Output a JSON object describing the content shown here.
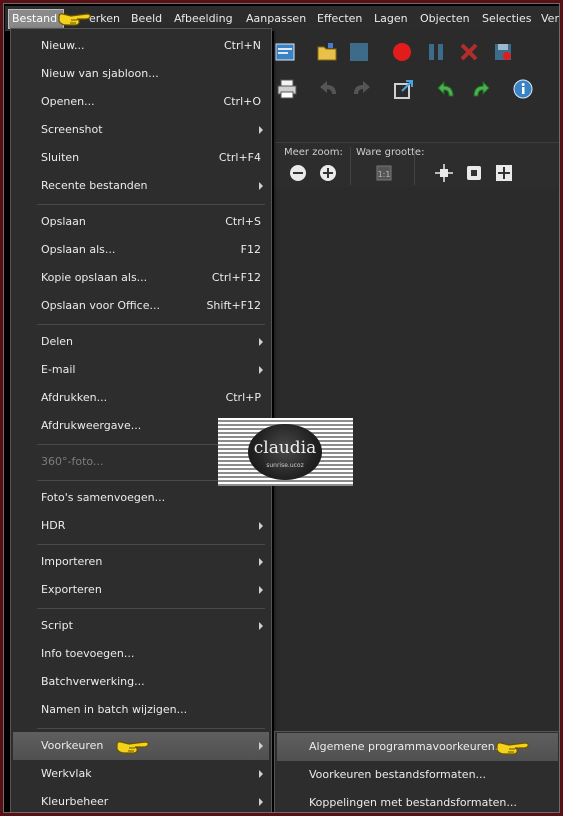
{
  "menubar": {
    "items": [
      "Bestand",
      "Bewerken",
      "Beeld",
      "Afbeelding",
      "Aanpassen",
      "Effecten",
      "Lagen",
      "Objecten",
      "Selecties",
      "Ven"
    ],
    "visible_text": [
      "Bestand",
      "erken",
      "Beeld",
      "Afbeelding",
      "Aanpassen",
      "Effecten",
      "Lagen",
      "Objecten",
      "Selecties",
      "Ven"
    ]
  },
  "toolbar": {
    "zoom_more_label": "Meer zoom:",
    "actual_size_label": "Ware grootte:"
  },
  "file_menu": {
    "items": [
      {
        "label": "Nieuw...",
        "shortcut": "Ctrl+N"
      },
      {
        "label": "Nieuw van sjabloon...",
        "shortcut": ""
      },
      {
        "label": "Openen...",
        "shortcut": "Ctrl+O"
      },
      {
        "label": "Screenshot",
        "shortcut": ""
      },
      {
        "label": "Sluiten",
        "shortcut": "Ctrl+F4"
      },
      {
        "label": "Recente bestanden",
        "shortcut": ""
      },
      {
        "label": "Opslaan",
        "shortcut": "Ctrl+S"
      },
      {
        "label": "Opslaan als...",
        "shortcut": "F12"
      },
      {
        "label": "Kopie opslaan als...",
        "shortcut": "Ctrl+F12"
      },
      {
        "label": "Opslaan voor Office...",
        "shortcut": "Shift+F12"
      },
      {
        "label": "Delen",
        "shortcut": ""
      },
      {
        "label": "E-mail",
        "shortcut": ""
      },
      {
        "label": "Afdrukken...",
        "shortcut": "Ctrl+P"
      },
      {
        "label": "Afdrukweergave...",
        "shortcut": ""
      },
      {
        "label": "360°-foto...",
        "shortcut": ""
      },
      {
        "label": "Foto's samenvoegen...",
        "shortcut": ""
      },
      {
        "label": "HDR",
        "shortcut": ""
      },
      {
        "label": "Importeren",
        "shortcut": ""
      },
      {
        "label": "Exporteren",
        "shortcut": ""
      },
      {
        "label": "Script",
        "shortcut": ""
      },
      {
        "label": "Info toevoegen...",
        "shortcut": ""
      },
      {
        "label": "Batchverwerking...",
        "shortcut": ""
      },
      {
        "label": "Namen in batch wijzigen...",
        "shortcut": ""
      },
      {
        "label": "Voorkeuren",
        "shortcut": ""
      },
      {
        "label": "Werkvlak",
        "shortcut": ""
      },
      {
        "label": "Kleurbeheer",
        "shortcut": ""
      }
    ]
  },
  "preferences_submenu": {
    "items": [
      {
        "label": "Algemene programmavoorkeuren..."
      },
      {
        "label": "Voorkeuren bestandsformaten..."
      },
      {
        "label": "Koppelingen met bestandsformaten..."
      }
    ]
  },
  "watermark": {
    "text": "claudia",
    "subtext": "sunrise.ucoz"
  },
  "colors": {
    "menu_bg": "#2d2d2d",
    "highlight": "#555555",
    "outer_border": "#5a0f14",
    "pointer_hand": "#f2d21b"
  },
  "icons": {
    "pointer": "pointing-hand-icon",
    "submenu": "chevron-right-icon"
  }
}
